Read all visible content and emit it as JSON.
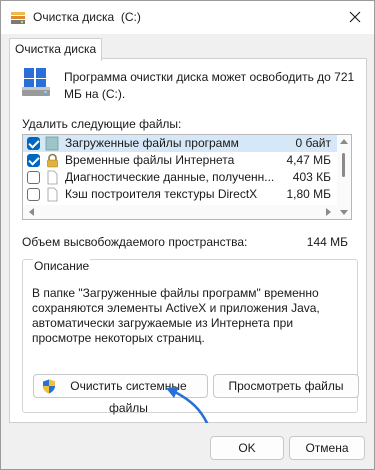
{
  "window": {
    "title": "Очистка диска  (C:)"
  },
  "tabs": [
    {
      "label": "Очистка диска"
    }
  ],
  "intro": {
    "text": "Программа очистки диска может освободить до 721 МБ на  (C:)."
  },
  "files": {
    "label": "Удалить следующие файлы:",
    "items": [
      {
        "name": "Загруженные файлы программ",
        "size": "0 байт",
        "checked": true,
        "selected": true,
        "icon": "folder-icon"
      },
      {
        "name": "Временные файлы Интернета",
        "size": "4,47 МБ",
        "checked": true,
        "selected": false,
        "icon": "lock-icon"
      },
      {
        "name": "Диагностические данные, полученн...",
        "size": "403 КБ",
        "checked": false,
        "selected": false,
        "icon": "blank-file-icon"
      },
      {
        "name": "Кэш построителя текстуры DirectX",
        "size": "1,80 МБ",
        "checked": false,
        "selected": false,
        "icon": "blank-file-icon"
      }
    ]
  },
  "space": {
    "label": "Объем высвобождаемого пространства:",
    "value": "144 МБ"
  },
  "description": {
    "title": "Описание",
    "text": "В папке \"Загруженные файлы программ\" временно сохраняются элементы ActiveX и приложения Java, автоматически загружаемые из Интернета при просмотре некоторых страниц."
  },
  "buttons": {
    "clean_system": "Очистить системные файлы",
    "view_files": "Просмотреть файлы",
    "ok": "OK",
    "cancel": "Отмена"
  },
  "colors": {
    "accent": "#0067c0",
    "selection": "#d6e8f7",
    "annotation_arrow": "#2a6fd6"
  }
}
